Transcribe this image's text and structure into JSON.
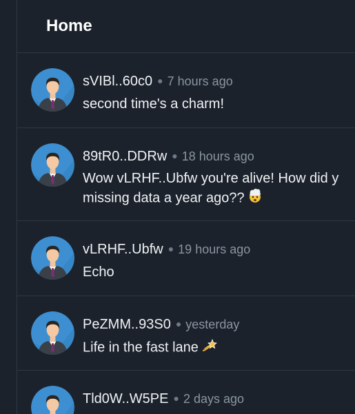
{
  "header": {
    "title": "Home"
  },
  "posts": [
    {
      "username": "sVIBl..60c0",
      "time": "7 hours ago",
      "lines": [
        "second time's a charm!"
      ]
    },
    {
      "username": "89tR0..DDRw",
      "time": "18 hours ago",
      "lines": [
        "Wow vLRHF..Ubfw you're alive! How did y",
        "missing data a year ago??"
      ],
      "emoji": "exploding-head-emoji"
    },
    {
      "username": "vLRHF..Ubfw",
      "time": "19 hours ago",
      "lines": [
        "Echo"
      ]
    },
    {
      "username": "PeZMM..93S0",
      "time": "yesterday",
      "lines": [
        "Life in the fast lane"
      ],
      "emoji": "dizzy-emoji"
    },
    {
      "username": "Tld0W..W5PE",
      "time": "2 days ago",
      "lines": []
    }
  ],
  "colors": {
    "background": "#1b222c",
    "divider": "#2d3743",
    "avatar_bg": "#3d8fd1",
    "text": "#f1f3f5",
    "muted": "#8b95a0"
  }
}
